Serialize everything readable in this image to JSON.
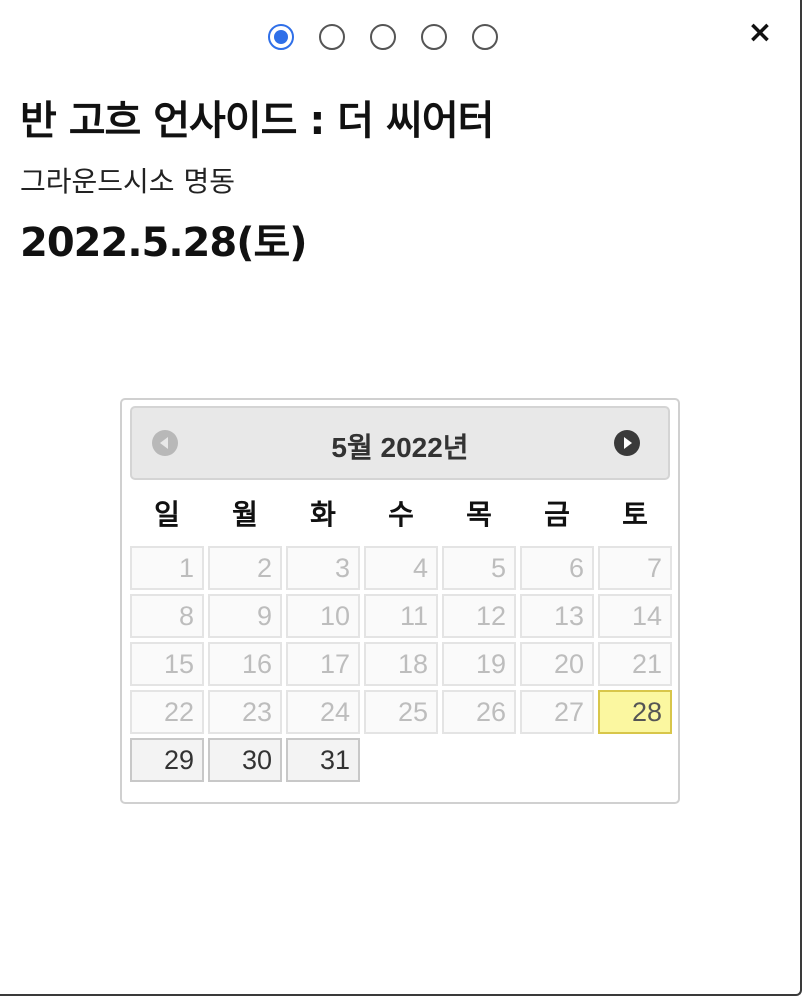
{
  "steps": [
    {
      "state": "active"
    },
    {
      "state": "inactive"
    },
    {
      "state": "inactive"
    },
    {
      "state": "inactive"
    },
    {
      "state": "inactive"
    }
  ],
  "close_label": "×",
  "show": {
    "title": "반 고흐 언사이드 : 더 씨어터",
    "venue": "그라운드시소 명동",
    "date": "2022.5.28(토)"
  },
  "calendar": {
    "title": "5월 2022년",
    "prev_icon": "chevron-left-icon",
    "next_icon": "chevron-right-icon",
    "weekdays": [
      "일",
      "월",
      "화",
      "수",
      "목",
      "금",
      "토"
    ],
    "selected_day": "28",
    "available_days": [
      "29",
      "30",
      "31"
    ],
    "days": [
      "1",
      "2",
      "3",
      "4",
      "5",
      "6",
      "7",
      "8",
      "9",
      "10",
      "11",
      "12",
      "13",
      "14",
      "15",
      "16",
      "17",
      "18",
      "19",
      "20",
      "21",
      "22",
      "23",
      "24",
      "25",
      "26",
      "27",
      "28",
      "29",
      "30",
      "31"
    ]
  },
  "colors": {
    "accent": "#2f6fe8",
    "selected_bg": "#fbf7a0",
    "selected_border": "#d8c64a"
  }
}
